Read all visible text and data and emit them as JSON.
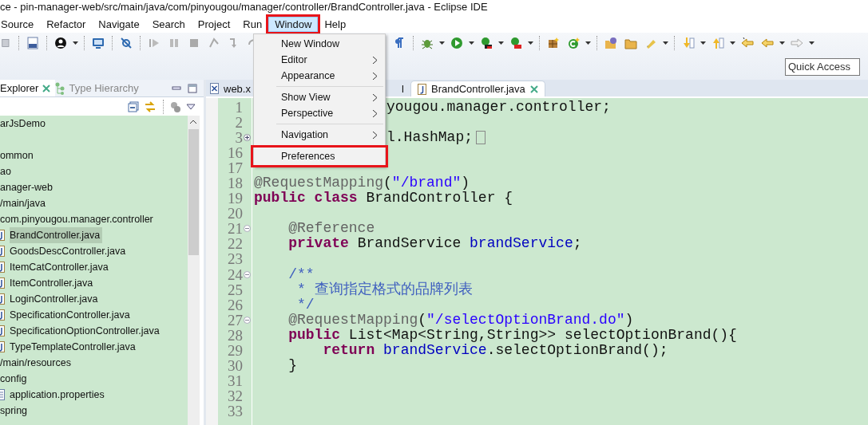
{
  "window": {
    "title": "ce - pin-manager-web/src/main/java/com/pinyougou/manager/controller/BrandController.java - Eclipse IDE"
  },
  "menubar": [
    {
      "label": "Source",
      "selected": false,
      "framed": false
    },
    {
      "label": "Refactor",
      "selected": false,
      "framed": false
    },
    {
      "label": "Navigate",
      "selected": false,
      "framed": false
    },
    {
      "label": "Search",
      "selected": false,
      "framed": false
    },
    {
      "label": "Project",
      "selected": false,
      "framed": false
    },
    {
      "label": "Run",
      "selected": false,
      "framed": false
    },
    {
      "label": "Window",
      "selected": true,
      "framed": true
    },
    {
      "label": "Help",
      "selected": false,
      "framed": false
    }
  ],
  "window_menu": [
    {
      "kind": "item",
      "label": "New Window",
      "submenu": false,
      "framed": false
    },
    {
      "kind": "item",
      "label": "Editor",
      "submenu": true,
      "framed": false
    },
    {
      "kind": "item",
      "label": "Appearance",
      "submenu": true,
      "framed": false
    },
    {
      "kind": "separator"
    },
    {
      "kind": "item",
      "label": "Show View",
      "submenu": true,
      "framed": false
    },
    {
      "kind": "item",
      "label": "Perspective",
      "submenu": true,
      "framed": false
    },
    {
      "kind": "separator"
    },
    {
      "kind": "item",
      "label": "Navigation",
      "submenu": true,
      "framed": false
    },
    {
      "kind": "separator"
    },
    {
      "kind": "item",
      "label": "Preferences",
      "submenu": false,
      "framed": true
    }
  ],
  "quick_access": {
    "placeholder": "Quick Access"
  },
  "left_panel": {
    "tabs": [
      {
        "label": "Explorer",
        "selected": true
      },
      {
        "label": "Type Hierarchy",
        "selected": false
      }
    ],
    "tree": [
      {
        "label": "arJsDemo",
        "selected": false
      },
      {
        "kind": "gap"
      },
      {
        "label": "ommon",
        "selected": false
      },
      {
        "label": "ao",
        "selected": false
      },
      {
        "label": "anager-web",
        "selected": false
      },
      {
        "label": "/main/java",
        "selected": false
      },
      {
        "label": "com.pinyougou.manager.controller",
        "selected": false,
        "children": [
          {
            "kind": "java",
            "label": "BrandController.java",
            "selected": true
          },
          {
            "kind": "java",
            "label": "GoodsDescController.java",
            "selected": false
          },
          {
            "kind": "java",
            "label": "ItemCatController.java",
            "selected": false
          },
          {
            "kind": "java",
            "label": "ItemController.java",
            "selected": false
          },
          {
            "kind": "java",
            "label": "LoginController.java",
            "selected": false
          },
          {
            "kind": "java",
            "label": "SpecificationController.java",
            "selected": false
          },
          {
            "kind": "java",
            "label": "SpecificationOptionController.java",
            "selected": false
          },
          {
            "kind": "java",
            "label": "TypeTemplateController.java",
            "selected": false
          }
        ]
      },
      {
        "label": "/main/resources",
        "selected": false
      },
      {
        "label": "config",
        "selected": false,
        "children": [
          {
            "kind": "properties",
            "label": "application.properties",
            "selected": false
          }
        ]
      },
      {
        "label": "spring",
        "selected": false
      }
    ]
  },
  "editor": {
    "tabs": [
      {
        "kind": "xml",
        "label": "web.x",
        "selected": false
      },
      {
        "kind": "partial",
        "label": "l",
        "selected": false
      },
      {
        "kind": "java",
        "label": "BrandController.java",
        "selected": true
      }
    ],
    "lines": [
      {
        "number": "1",
        "covered": true,
        "tokens": [
          {
            "kind": "plain",
            "text": "yougou.manager.controller;"
          }
        ]
      },
      {
        "number": "2"
      },
      {
        "number": "3",
        "covered": true,
        "folded": true,
        "tokens": [
          {
            "kind": "plain",
            "text": "l.HashMap;"
          }
        ]
      },
      {
        "number": "16"
      },
      {
        "number": "17"
      },
      {
        "number": "18",
        "tokens": [
          {
            "kind": "annotation",
            "text": "@RequestMapping"
          },
          {
            "kind": "plain",
            "text": "("
          },
          {
            "kind": "string",
            "text": "\"/brand\""
          },
          {
            "kind": "plain",
            "text": ")"
          }
        ]
      },
      {
        "number": "19",
        "tokens": [
          {
            "kind": "keyword",
            "text": "public class"
          },
          {
            "kind": "plain",
            "text": " BrandController {"
          }
        ]
      },
      {
        "number": "20"
      },
      {
        "number": "21",
        "folded": false,
        "tokens": [
          {
            "kind": "annotation",
            "text": "    @Reference"
          }
        ]
      },
      {
        "number": "22",
        "tokens": [
          {
            "kind": "keyword",
            "text": "    private"
          },
          {
            "kind": "plain",
            "text": " BrandService "
          },
          {
            "kind": "field",
            "text": "brandService"
          },
          {
            "kind": "plain",
            "text": ";"
          }
        ]
      },
      {
        "number": "23"
      },
      {
        "number": "24",
        "folded": false,
        "tokens": [
          {
            "kind": "comment",
            "text": "    /**"
          }
        ]
      },
      {
        "number": "25",
        "tokens": [
          {
            "kind": "comment",
            "text": "     * 查询指定格式的品牌列表"
          }
        ]
      },
      {
        "number": "26",
        "tokens": [
          {
            "kind": "comment",
            "text": "     */"
          }
        ]
      },
      {
        "number": "27",
        "folded": false,
        "tokens": [
          {
            "kind": "annotation",
            "text": "    @RequestMapping"
          },
          {
            "kind": "plain",
            "text": "("
          },
          {
            "kind": "string",
            "text": "\"/selectOptionBrand.do\""
          },
          {
            "kind": "plain",
            "text": ")"
          }
        ]
      },
      {
        "number": "28",
        "tokens": [
          {
            "kind": "keyword",
            "text": "    public"
          },
          {
            "kind": "plain",
            "text": " List<Map<String,String>> selectOptionBrand(){"
          }
        ]
      },
      {
        "number": "29",
        "tokens": [
          {
            "kind": "keyword",
            "text": "        return "
          },
          {
            "kind": "field",
            "text": "brandService"
          },
          {
            "kind": "plain",
            "text": ".selectOptionBrand();"
          }
        ]
      },
      {
        "number": "30",
        "tokens": [
          {
            "kind": "plain",
            "text": "    }"
          }
        ]
      },
      {
        "number": "31"
      },
      {
        "number": "32"
      },
      {
        "number": "33"
      }
    ]
  }
}
